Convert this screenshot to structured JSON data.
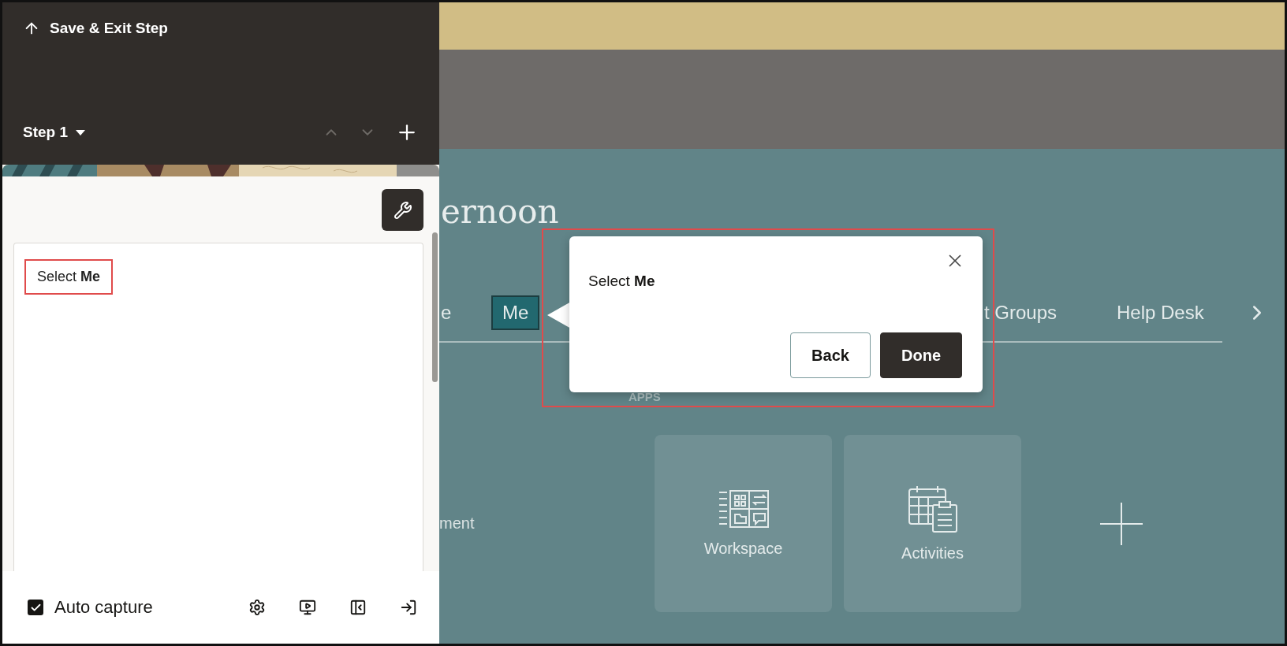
{
  "editor": {
    "save_exit": "Save & Exit Step",
    "step": {
      "label": "Step 1"
    },
    "step_nav": [
      {
        "kind": "up",
        "disabled": true
      },
      {
        "kind": "down",
        "disabled": true
      },
      {
        "kind": "add",
        "disabled": false
      }
    ],
    "content": {
      "text": "Select **Me**"
    },
    "footer": {
      "auto_capture": {
        "label": "Auto capture",
        "checked": true
      }
    }
  },
  "page": {
    "greeting": "ernoon",
    "tabs": [
      {
        "label": "e",
        "selected": false
      },
      {
        "label": "Me",
        "selected": true
      },
      {
        "label": "t Groups",
        "selected": false
      },
      {
        "label": "Help Desk",
        "selected": false
      }
    ],
    "section": "APPS",
    "side_text": "ment",
    "apps": [
      {
        "label": "Workspace",
        "kind": "workspace"
      },
      {
        "label": "Activities",
        "kind": "activities"
      },
      {
        "kind": "add"
      }
    ]
  },
  "popup": {
    "text": "Select **Me**",
    "buttons": [
      {
        "label": "Back",
        "kind": "secondary"
      },
      {
        "label": "Done",
        "kind": "primary"
      }
    ]
  }
}
